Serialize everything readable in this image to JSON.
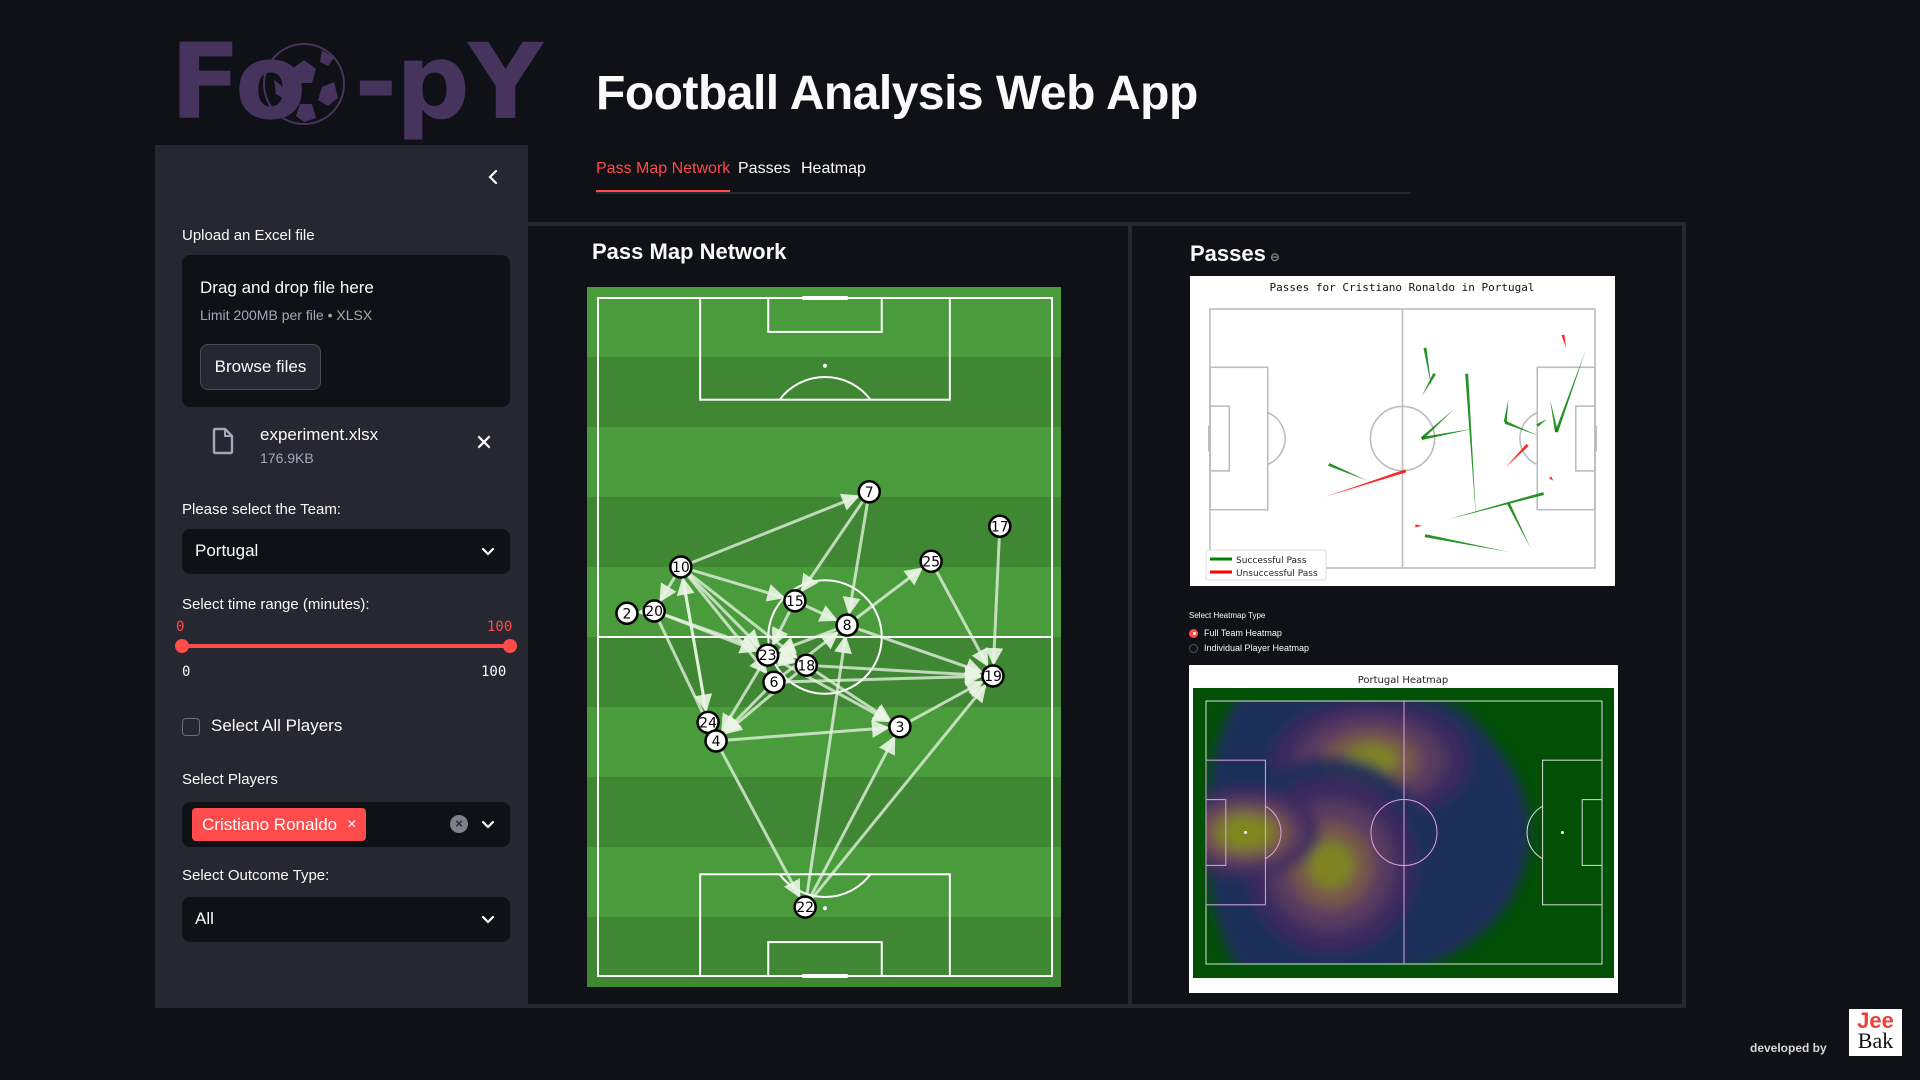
{
  "logo": {
    "text_left": "Fo",
    "text_right": "-pY",
    "icon": "soccer-ball-icon",
    "color": "#46345f"
  },
  "header": {
    "title": "Football Analysis Web App"
  },
  "tabs": [
    {
      "label": "Pass Map Network",
      "active": true
    },
    {
      "label": "Passes",
      "active": false
    },
    {
      "label": "Heatmap",
      "active": false
    }
  ],
  "sidebar": {
    "collapse_icon": "chevron-left-icon",
    "upload": {
      "label": "Upload an Excel file",
      "drop_title": "Drag and drop file here",
      "drop_sub": "Limit 200MB per file • XLSX",
      "browse_label": "Browse files",
      "file": {
        "name": "experiment.xlsx",
        "size": "176.9KB",
        "icon": "file-icon",
        "remove_icon": "close-icon"
      }
    },
    "team": {
      "label": "Please select the Team:",
      "value": "Portugal"
    },
    "time_range": {
      "label": "Select time range (minutes):",
      "low": "0",
      "high": "100",
      "min": "0",
      "max": "100",
      "low_value": 0,
      "high_value": 100
    },
    "select_all": {
      "label": "Select All Players",
      "checked": false
    },
    "players": {
      "label": "Select Players",
      "selected": [
        "Cristiano Ronaldo"
      ],
      "tag_remove": "×"
    },
    "outcome": {
      "label": "Select Outcome Type:",
      "value": "All"
    }
  },
  "accent": "#ff4b4b",
  "left_panel": {
    "title": "Pass Map Network"
  },
  "right_panel": {
    "title": "Passes",
    "link_icon": "link-icon",
    "heatmap_type": {
      "label": "Select Heatmap Type",
      "options": [
        {
          "label": "Full Team Heatmap",
          "selected": true
        },
        {
          "label": "Individual Player Heatmap",
          "selected": false
        }
      ]
    }
  },
  "footer": {
    "developed_by": "developed by",
    "brand_top": "Jee",
    "brand_bottom": "Bak"
  },
  "chart_data": [
    {
      "type": "scatter",
      "title": "Pass Map Network",
      "description": "Pass network on vertical pitch (length 0-120 bottom to top, width 0-80 left to right)",
      "xlim": [
        0,
        80
      ],
      "ylim": [
        0,
        120
      ],
      "nodes": [
        {
          "id": "7",
          "x": 47.8,
          "y": 85.7
        },
        {
          "id": "17",
          "x": 70.8,
          "y": 79.6
        },
        {
          "id": "10",
          "x": 14.6,
          "y": 72.4
        },
        {
          "id": "25",
          "x": 58.7,
          "y": 73.4
        },
        {
          "id": "2",
          "x": 5.1,
          "y": 64.2
        },
        {
          "id": "20",
          "x": 9.9,
          "y": 64.6
        },
        {
          "id": "15",
          "x": 34.7,
          "y": 66.4
        },
        {
          "id": "8",
          "x": 43.9,
          "y": 62.1
        },
        {
          "id": "23",
          "x": 29.9,
          "y": 56.8
        },
        {
          "id": "18",
          "x": 36.7,
          "y": 55.0
        },
        {
          "id": "6",
          "x": 31.0,
          "y": 52.0
        },
        {
          "id": "19",
          "x": 69.6,
          "y": 53.1
        },
        {
          "id": "24",
          "x": 19.4,
          "y": 44.9
        },
        {
          "id": "4",
          "x": 20.8,
          "y": 41.6
        },
        {
          "id": "3",
          "x": 53.2,
          "y": 44.1
        },
        {
          "id": "22",
          "x": 36.5,
          "y": 12.2
        }
      ],
      "edges": [
        [
          "10",
          "7"
        ],
        [
          "7",
          "15"
        ],
        [
          "7",
          "8"
        ],
        [
          "10",
          "20"
        ],
        [
          "20",
          "2"
        ],
        [
          "10",
          "15"
        ],
        [
          "10",
          "23"
        ],
        [
          "10",
          "18"
        ],
        [
          "10",
          "6"
        ],
        [
          "10",
          "24"
        ],
        [
          "15",
          "8"
        ],
        [
          "15",
          "23"
        ],
        [
          "8",
          "25"
        ],
        [
          "8",
          "23"
        ],
        [
          "8",
          "19"
        ],
        [
          "25",
          "19"
        ],
        [
          "17",
          "19"
        ],
        [
          "20",
          "23"
        ],
        [
          "20",
          "18"
        ],
        [
          "20",
          "4"
        ],
        [
          "23",
          "18"
        ],
        [
          "23",
          "4"
        ],
        [
          "6",
          "4"
        ],
        [
          "18",
          "4"
        ],
        [
          "6",
          "19"
        ],
        [
          "18",
          "19"
        ],
        [
          "23",
          "3"
        ],
        [
          "18",
          "3"
        ],
        [
          "4",
          "3"
        ],
        [
          "3",
          "19"
        ],
        [
          "24",
          "10"
        ],
        [
          "4",
          "22"
        ],
        [
          "22",
          "3"
        ],
        [
          "22",
          "19"
        ],
        [
          "22",
          "8"
        ],
        [
          "6",
          "8"
        ]
      ]
    },
    {
      "type": "line",
      "title": "Passes for Cristiano Ronaldo   in Portugal",
      "description": "Horizontal pitch 0-120 x 0-80, pass arrows",
      "xlim": [
        0,
        120
      ],
      "ylim": [
        0,
        80
      ],
      "legend": [
        "Successful Pass",
        "Unsuccessful Pass"
      ],
      "legend_position": "lower-left",
      "colors": {
        "Successful Pass": "#008000",
        "Unsuccessful Pass": "#ff0000"
      },
      "series": [
        {
          "name": "Successful Pass",
          "passes": [
            [
              67,
              68,
              69,
              56
            ],
            [
              70,
              60,
              66,
              53
            ],
            [
              80,
              60,
              83,
              14
            ],
            [
              92,
              45,
              102,
              41
            ],
            [
              92,
              45,
              93,
              52
            ],
            [
              102,
              44,
              105,
              46
            ],
            [
              108,
              42,
              106,
              52
            ],
            [
              108,
              42,
              117,
              67
            ],
            [
              66,
              40,
              76,
              49
            ],
            [
              66,
              40,
              82,
              43
            ],
            [
              37,
              32,
              49,
              27
            ],
            [
              104,
              23,
              74,
              15
            ],
            [
              93,
              20,
              100,
              6
            ],
            [
              67,
              10,
              93,
              5
            ]
          ]
        },
        {
          "name": "Unsuccessful Pass",
          "passes": [
            [
              61,
              30,
              36,
              22
            ],
            [
              99,
              38,
              92,
              31
            ],
            [
              110,
              72,
              111,
              68
            ],
            [
              106,
              28,
              107,
              27
            ],
            [
              64,
              13,
              66,
              13
            ]
          ]
        }
      ]
    },
    {
      "type": "heatmap",
      "title": "Portugal Heatmap",
      "description": "KDE of team actions; hot zones in left-center attacking third of own half",
      "hotspots": [
        {
          "x": 50,
          "y": 62,
          "intensity": 1.0
        },
        {
          "x": 38,
          "y": 30,
          "intensity": 0.85
        },
        {
          "x": 12,
          "y": 40,
          "intensity": 0.6
        }
      ],
      "colors": [
        "#1f2d5a",
        "#3e2a5e",
        "#5c3d61",
        "#7a5a48",
        "#7f8a1f"
      ],
      "pitch_color": "#015006"
    }
  ]
}
